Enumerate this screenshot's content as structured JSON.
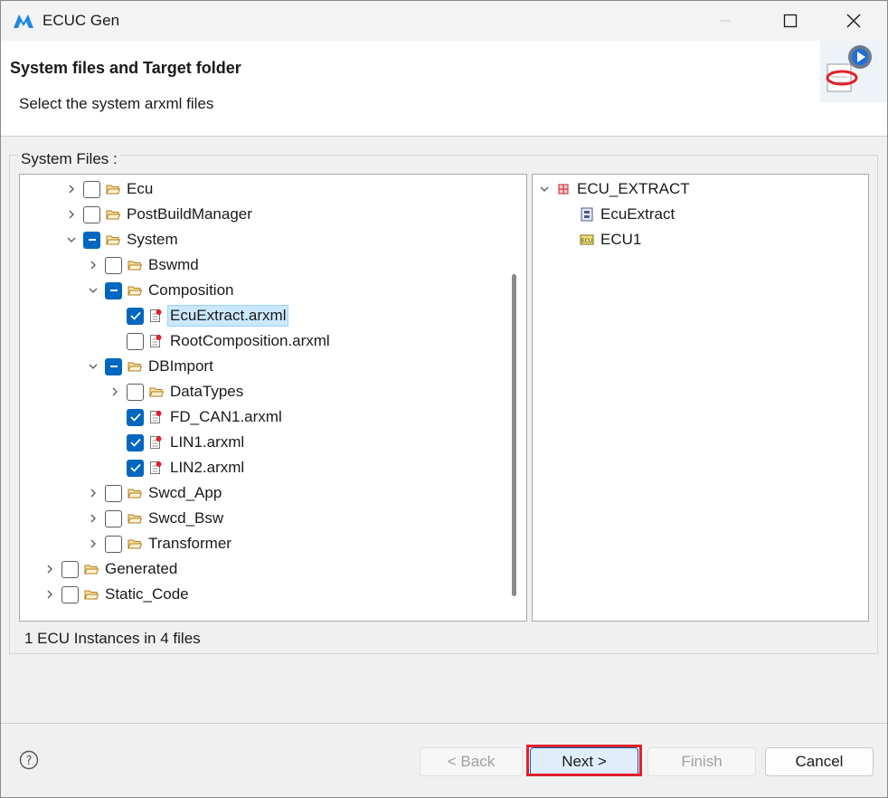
{
  "window": {
    "title": "ECUC Gen"
  },
  "header": {
    "title": "System files and Target folder",
    "subtitle": "Select the system arxml files"
  },
  "group": {
    "label": "System Files :"
  },
  "tree": [
    {
      "label": "Ecu",
      "type": "folder",
      "expand": "collapsed",
      "check": "unchecked",
      "level": 2
    },
    {
      "label": "PostBuildManager",
      "type": "folder",
      "expand": "collapsed",
      "check": "unchecked",
      "level": 2
    },
    {
      "label": "System",
      "type": "folder",
      "expand": "expanded",
      "check": "partial",
      "level": 2
    },
    {
      "label": "Bswmd",
      "type": "folder",
      "expand": "collapsed",
      "check": "unchecked",
      "level": 3
    },
    {
      "label": "Composition",
      "type": "folder",
      "expand": "expanded",
      "check": "partial",
      "level": 3
    },
    {
      "label": "EcuExtract.arxml",
      "type": "file",
      "expand": "none",
      "check": "checked",
      "level": 4,
      "selected": true
    },
    {
      "label": "RootComposition.arxml",
      "type": "file",
      "expand": "none",
      "check": "unchecked",
      "level": 4
    },
    {
      "label": "DBImport",
      "type": "folder",
      "expand": "expanded",
      "check": "partial",
      "level": 3
    },
    {
      "label": "DataTypes",
      "type": "folder",
      "expand": "collapsed",
      "check": "unchecked",
      "level": 4
    },
    {
      "label": "FD_CAN1.arxml",
      "type": "file",
      "expand": "none",
      "check": "checked",
      "level": 4
    },
    {
      "label": "LIN1.arxml",
      "type": "file",
      "expand": "none",
      "check": "checked",
      "level": 4
    },
    {
      "label": "LIN2.arxml",
      "type": "file",
      "expand": "none",
      "check": "checked",
      "level": 4
    },
    {
      "label": "Swcd_App",
      "type": "folder",
      "expand": "collapsed",
      "check": "unchecked",
      "level": 3
    },
    {
      "label": "Swcd_Bsw",
      "type": "folder",
      "expand": "collapsed",
      "check": "unchecked",
      "level": 3
    },
    {
      "label": "Transformer",
      "type": "folder",
      "expand": "collapsed",
      "check": "unchecked",
      "level": 3
    },
    {
      "label": "Generated",
      "type": "folder",
      "expand": "collapsed",
      "check": "unchecked",
      "level": 1
    },
    {
      "label": "Static_Code",
      "type": "folder",
      "expand": "collapsed",
      "check": "unchecked",
      "level": 1
    }
  ],
  "ecu_tree": [
    {
      "label": "ECU_EXTRACT",
      "icon": "package-icon",
      "expand": "expanded",
      "level": 0
    },
    {
      "label": "EcuExtract",
      "icon": "system-icon",
      "expand": "none",
      "level": 1
    },
    {
      "label": "ECU1",
      "icon": "ecu-chip-icon",
      "expand": "none",
      "level": 1
    }
  ],
  "status": "1 ECU Instances in 4 files",
  "buttons": {
    "back": "< Back",
    "next": "Next >",
    "finish": "Finish",
    "cancel": "Cancel"
  },
  "colors": {
    "accent": "#0067c0",
    "highlight": "#e0202a",
    "selection": "#cce8ff"
  }
}
